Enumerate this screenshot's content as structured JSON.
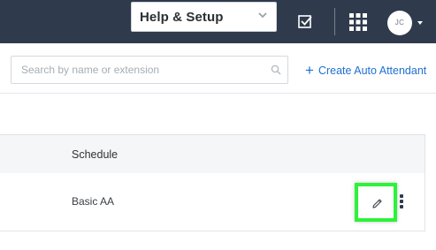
{
  "header": {
    "help_select_label": "Help & Setup",
    "avatar_initials": "JC",
    "icons": [
      "chevron-down-icon",
      "checkbox-icon",
      "apps-grid-icon",
      "caret-down-icon"
    ]
  },
  "toolbar": {
    "search_placeholder": "Search by name or extension",
    "search_value": "",
    "create_label": "Create Auto Attendant",
    "create_icon": "+"
  },
  "table": {
    "columns": [
      "Schedule"
    ],
    "rows": [
      {
        "schedule": "Basic AA"
      }
    ]
  },
  "colors": {
    "topbar": "#2f3b4c",
    "link": "#1f6fd1",
    "highlight": "#2df23a"
  }
}
